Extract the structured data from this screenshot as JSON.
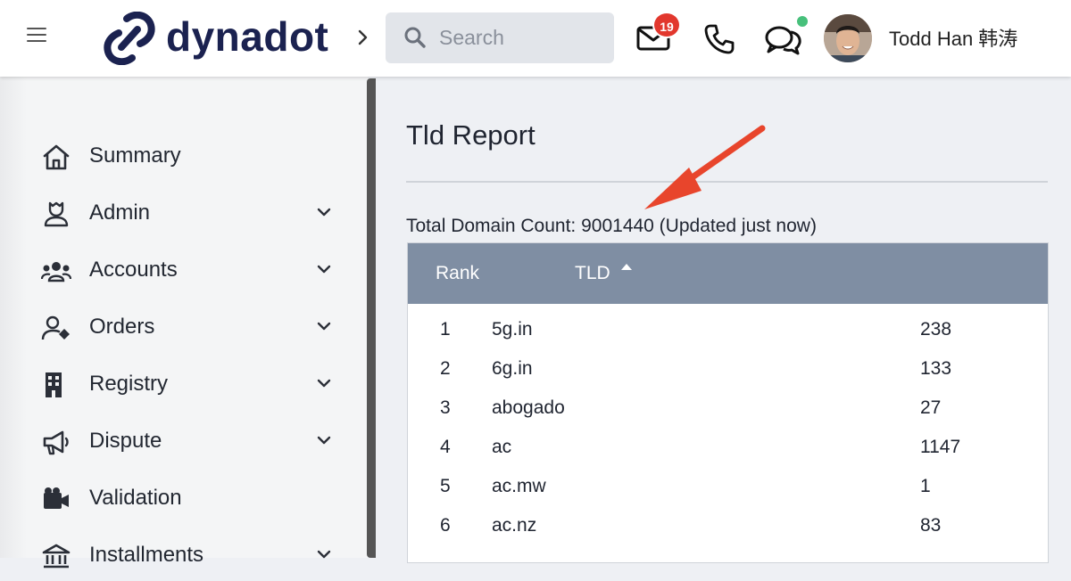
{
  "header": {
    "brand": "dynadot",
    "search_placeholder": "Search",
    "mail_badge": "19",
    "user_name": "Todd Han 韩涛",
    "accent_badge_color": "#e2372d",
    "online_color": "#47c07b"
  },
  "sidebar": {
    "items": [
      {
        "label": "Summary",
        "icon": "home-icon",
        "expandable": false
      },
      {
        "label": "Admin",
        "icon": "admin-user-icon",
        "expandable": true
      },
      {
        "label": "Accounts",
        "icon": "users-group-icon",
        "expandable": true
      },
      {
        "label": "Orders",
        "icon": "user-tag-icon",
        "expandable": true
      },
      {
        "label": "Registry",
        "icon": "building-icon",
        "expandable": true
      },
      {
        "label": "Dispute",
        "icon": "megaphone-icon",
        "expandable": true
      },
      {
        "label": "Validation",
        "icon": "id-card-icon",
        "expandable": false
      },
      {
        "label": "Installments",
        "icon": "bank-icon",
        "expandable": true
      }
    ]
  },
  "main": {
    "title": "Tld Report",
    "summary": "Total Domain Count: 9001440 (Updated just now)",
    "table": {
      "header_color": "#7f8ea3",
      "columns": [
        "Rank",
        "TLD"
      ],
      "sort": {
        "column": "TLD",
        "direction": "ascending"
      },
      "rows": [
        {
          "rank": "1",
          "tld": "5g.in",
          "count": "238"
        },
        {
          "rank": "2",
          "tld": "6g.in",
          "count": "133"
        },
        {
          "rank": "3",
          "tld": "abogado",
          "count": "27"
        },
        {
          "rank": "4",
          "tld": "ac",
          "count": "1147"
        },
        {
          "rank": "5",
          "tld": "ac.mw",
          "count": "1"
        },
        {
          "rank": "6",
          "tld": "ac.nz",
          "count": "83"
        }
      ]
    }
  },
  "annotation": {
    "arrow_color": "#e8452c"
  }
}
